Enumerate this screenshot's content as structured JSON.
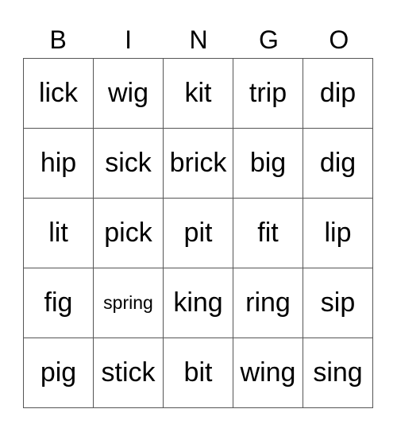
{
  "header": {
    "letters": [
      "B",
      "I",
      "N",
      "G",
      "O"
    ]
  },
  "grid": {
    "rows": [
      [
        "lick",
        "wig",
        "kit",
        "trip",
        "dip"
      ],
      [
        "hip",
        "sick",
        "brick",
        "big",
        "dig"
      ],
      [
        "lit",
        "pick",
        "pit",
        "fit",
        "lip"
      ],
      [
        "fig",
        "spring",
        "king",
        "ring",
        "sip"
      ],
      [
        "pig",
        "stick",
        "bit",
        "wing",
        "sing"
      ]
    ]
  }
}
